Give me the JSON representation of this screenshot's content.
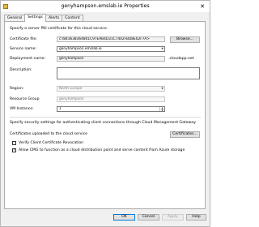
{
  "window": {
    "title": "genyhampson.emslab.ie Properties",
    "close_glyph": "✕",
    "icon": "app-icon"
  },
  "tabs": [
    {
      "label": "General",
      "active": false
    },
    {
      "label": "Settings",
      "active": true
    },
    {
      "label": "Alerts",
      "active": false
    },
    {
      "label": "Content",
      "active": false
    }
  ],
  "settings": {
    "intro": "Specify a server PKI certificate for this cloud service.",
    "certificate_file_label": "Certificate file:",
    "certificate_file_value": "c:\\843638364801C97EAB4D31C7402FBD8E02F7A>",
    "browse_label": "Browse...",
    "service_name_label": "Service name:",
    "service_name_value": "genyhampson.emslab.ie",
    "deployment_name_label": "Deployment name:",
    "deployment_name_value": "genyhampson",
    "deployment_suffix": ".cloudapp.net",
    "description_label": "Description:",
    "description_value": "",
    "region_label": "Region:",
    "region_value": "North Europe",
    "resource_group_label": "Resource Group",
    "resource_group_value": "genyhampson",
    "vm_instance_label": "VM Instance:",
    "vm_instance_value": "1",
    "client_intro": "Specify security settings for authenticating client connections through Cloud Management Gateway.",
    "certificates_uploaded_label": "Certificates uploaded to the cloud service",
    "certificates_button_label": "Certificates...",
    "verify_crl_label": "Verify Client Certificate Revocation",
    "verify_crl_checked": false,
    "allow_cmg_label": "Allow CMG to function as a cloud distribution point and serve content from Azure storage",
    "allow_cmg_checked": true,
    "check_glyph": "✓"
  },
  "footer": {
    "ok_label": "OK",
    "cancel_label": "Cancel",
    "apply_label": "Apply",
    "help_label": "Help"
  }
}
